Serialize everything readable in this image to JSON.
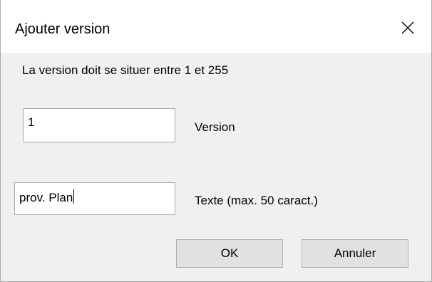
{
  "window": {
    "title": "Ajouter version",
    "close_icon": "close-icon"
  },
  "message": "La version doit se situer entre 1 et 255",
  "fields": {
    "version": {
      "value": "1",
      "label": "Version"
    },
    "text": {
      "value": "prov. Plan",
      "label": "Texte (max. 50 caract.)"
    }
  },
  "buttons": {
    "ok": "OK",
    "cancel": "Annuler"
  }
}
